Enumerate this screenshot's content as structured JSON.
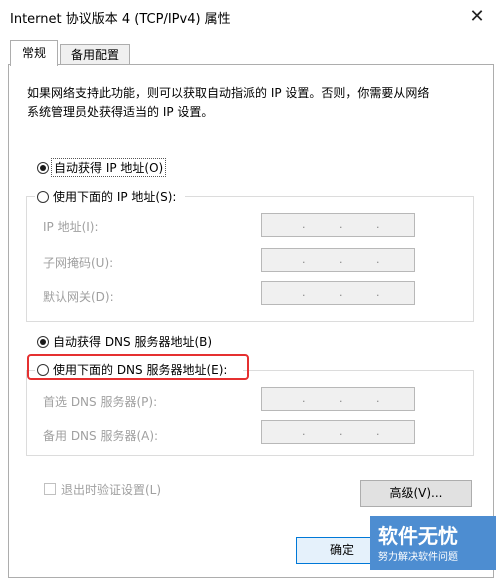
{
  "window": {
    "title": "Internet 协议版本 4 (TCP/IPv4) 属性",
    "close_glyph": "✕"
  },
  "tabs": [
    {
      "label": "常规",
      "active": true
    },
    {
      "label": "备用配置",
      "active": false
    }
  ],
  "description": {
    "line1": "如果网络支持此功能，则可以获取自动指派的 IP 设置。否则，你需要从网络",
    "line2": "系统管理员处获得适当的 IP 设置。"
  },
  "ip": {
    "auto_label": "自动获得 IP 地址(O)",
    "auto_selected": true,
    "manual_label": "使用下面的 IP 地址(S):",
    "manual_selected": false,
    "fields": [
      {
        "label": "IP 地址(I):",
        "value": ". . ."
      },
      {
        "label": "子网掩码(U):",
        "value": ". . ."
      },
      {
        "label": "默认网关(D):",
        "value": ". . ."
      }
    ]
  },
  "dns": {
    "auto_label": "自动获得 DNS 服务器地址(B)",
    "auto_selected": true,
    "manual_label": "使用下面的 DNS 服务器地址(E):",
    "manual_selected": false,
    "fields": [
      {
        "label": "首选 DNS 服务器(P):",
        "value": ". . ."
      },
      {
        "label": "备用 DNS 服务器(A):",
        "value": ". . ."
      }
    ]
  },
  "validate_label": "退出时验证设置(L)",
  "validate_checked": false,
  "advanced_button": "高级(V)...",
  "ok_button": "确定",
  "watermark": {
    "main": "软件无忧",
    "sub": "努力解决软件问题"
  },
  "colors": {
    "highlight": "#e53030",
    "watermark_bg": "#4d8dd1",
    "disabled_text": "#a0a0a0"
  }
}
